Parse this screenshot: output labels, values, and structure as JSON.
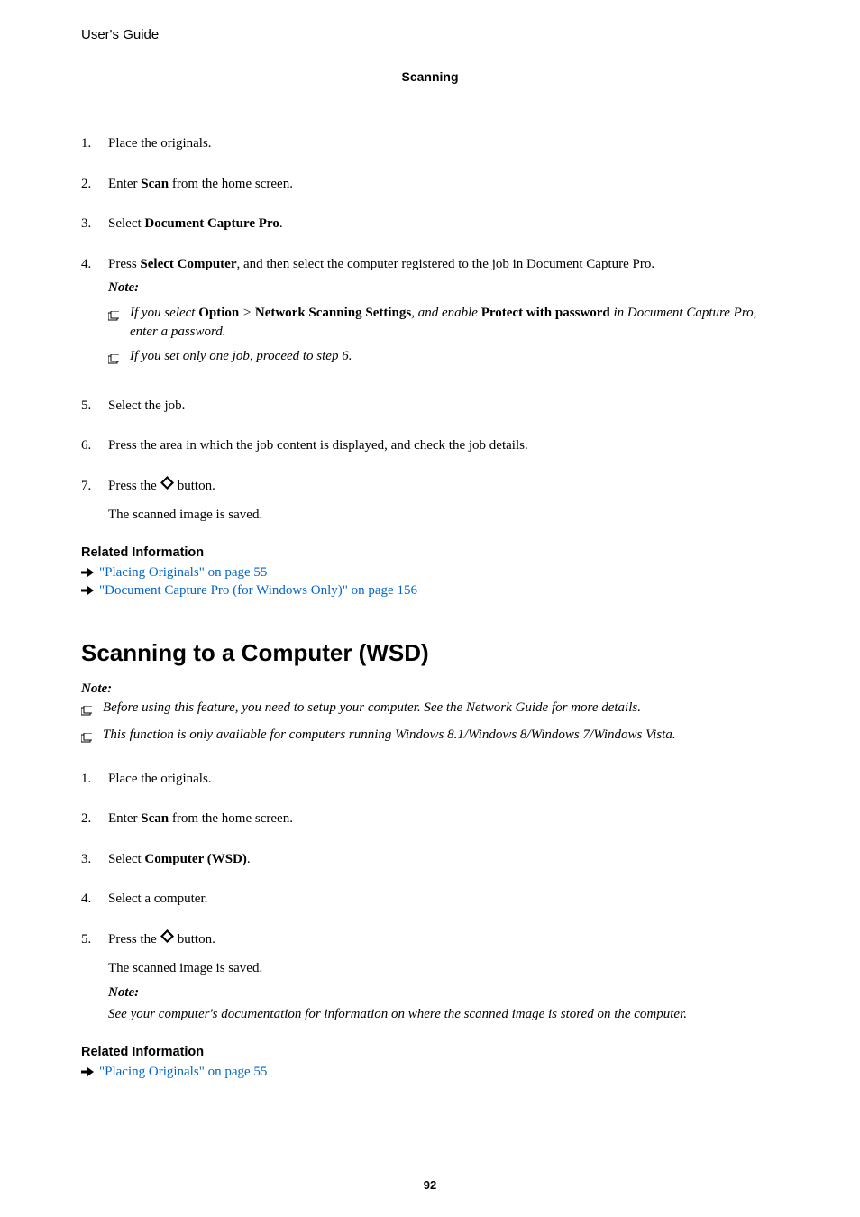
{
  "header": {
    "title": "User's Guide"
  },
  "section": {
    "title": "Scanning"
  },
  "list1": {
    "items": [
      {
        "num": "1.",
        "text": "Place the originals."
      },
      {
        "num": "2.",
        "pre": "Enter ",
        "bold": "Scan",
        "post": " from the home screen."
      },
      {
        "num": "3.",
        "pre": "Select ",
        "bold": "Document Capture Pro",
        "post": "."
      },
      {
        "num": "4.",
        "pre": "Press ",
        "bold": "Select Computer",
        "post": ", and then select the computer registered to the job in Document Capture Pro."
      },
      {
        "num": "5.",
        "text": "Select the job."
      },
      {
        "num": "6.",
        "text": "Press the area in which the job content is displayed, and check the job details."
      },
      {
        "num": "7.",
        "pre": "Press the ",
        "post": " button."
      }
    ],
    "note4": {
      "label": "Note:",
      "sub1_a": "If you select ",
      "sub1_b": "Option",
      "sub1_c": " > ",
      "sub1_d": "Network Scanning Settings",
      "sub1_e": ", and enable ",
      "sub1_f": "Protect with password",
      "sub1_g": " in Document Capture Pro, enter a password.",
      "sub2": "If you set only one job, proceed to step 6."
    },
    "result7": "The scanned image is saved."
  },
  "related1": {
    "heading": "Related Information",
    "link1": "\"Placing Originals\" on page 55",
    "link2": "\"Document Capture Pro (for Windows Only)\" on page 156"
  },
  "h2": "Scanning to a Computer (WSD)",
  "note_h2": {
    "label": "Note:",
    "sub1": "Before using this feature, you need to setup your computer. See the Network Guide for more details.",
    "sub2": "This function is only available for computers running Windows 8.1/Windows 8/Windows 7/Windows Vista."
  },
  "list2": {
    "items": [
      {
        "num": "1.",
        "text": "Place the originals."
      },
      {
        "num": "2.",
        "pre": "Enter ",
        "bold": "Scan",
        "post": " from the home screen."
      },
      {
        "num": "3.",
        "pre": "Select ",
        "bold": "Computer (WSD)",
        "post": "."
      },
      {
        "num": "4.",
        "text": "Select a computer."
      },
      {
        "num": "5.",
        "pre": "Press the ",
        "post": " button."
      }
    ],
    "result5": "The scanned image is saved.",
    "note5": {
      "label": "Note:",
      "text": "See your computer's documentation for information on where the scanned image is stored on the computer."
    }
  },
  "related2": {
    "heading": "Related Information",
    "link1": "\"Placing Originals\" on page 55"
  },
  "page": "92"
}
